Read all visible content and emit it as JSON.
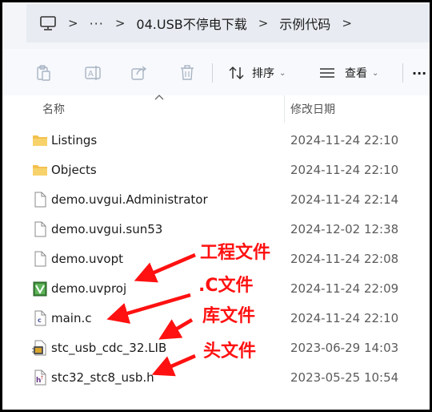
{
  "address": {
    "crumbs": [
      "04.USB不停电下载",
      "示例代码"
    ],
    "overflow": "···"
  },
  "toolbar": {
    "sort_label": "排序",
    "view_label": "查看",
    "more_label": "···"
  },
  "columns": {
    "name": "名称",
    "date": "修改日期"
  },
  "files": [
    {
      "name": "Listings",
      "date": "2024-11-24 22:10",
      "icon": "folder-icon"
    },
    {
      "name": "Objects",
      "date": "2024-11-24 22:10",
      "icon": "folder-icon"
    },
    {
      "name": "demo.uvgui.Administrator",
      "date": "2024-11-24 22:14",
      "icon": "file-icon"
    },
    {
      "name": "demo.uvgui.sun53",
      "date": "2024-12-02 12:38",
      "icon": "file-icon"
    },
    {
      "name": "demo.uvopt",
      "date": "2024-11-24 22:08",
      "icon": "file-icon"
    },
    {
      "name": "demo.uvproj",
      "date": "2024-11-24 22:09",
      "icon": "keil-project-icon"
    },
    {
      "name": "main.c",
      "date": "2024-11-24 22:10",
      "icon": "c-source-icon"
    },
    {
      "name": "stc_usb_cdc_32.LIB",
      "date": "2023-06-29 14:03",
      "icon": "library-icon"
    },
    {
      "name": "stc32_stc8_usb.h",
      "date": "2023-05-25 10:54",
      "icon": "header-file-icon"
    }
  ],
  "annotations": [
    "工程文件",
    ".C文件",
    "库文件",
    "头文件"
  ],
  "colors": {
    "annotation": "#ff1111",
    "folder": "#f2c14e"
  }
}
